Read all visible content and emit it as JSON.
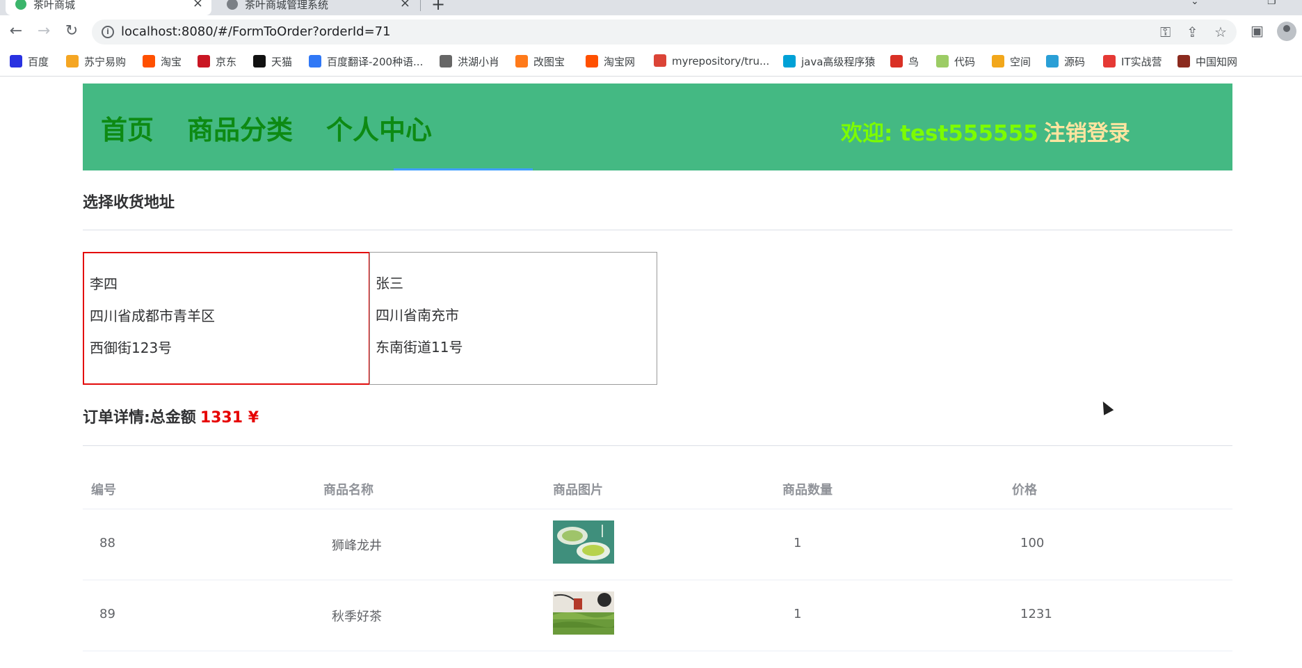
{
  "browser": {
    "tabs": [
      {
        "title": "茶叶商城",
        "active": true
      },
      {
        "title": "茶叶商城管理系统",
        "active": false
      }
    ],
    "url": "localhost:8080/#/FormToOrder?orderId=71",
    "bookmarks": [
      {
        "label": "百度",
        "icon": "baidu-paw-icon",
        "color": "#2932e1"
      },
      {
        "label": "苏宁易购",
        "icon": "suning-lion-icon",
        "color": "#f5a623"
      },
      {
        "label": "淘宝",
        "icon": "taobao-icon",
        "color": "#ff5000"
      },
      {
        "label": "京东",
        "icon": "jd-icon",
        "color": "#c91623"
      },
      {
        "label": "天猫",
        "icon": "tmall-icon",
        "color": "#111111"
      },
      {
        "label": "百度翻译-200种语...",
        "icon": "translate-icon",
        "color": "#3078f6"
      },
      {
        "label": "洪湖小肖",
        "icon": "bird-icon",
        "color": "#666666"
      },
      {
        "label": "改图宝",
        "icon": "gaitubao-icon",
        "color": "#ff7a1a"
      },
      {
        "label": "淘宝网",
        "icon": "taobao-icon",
        "color": "#ff5000"
      },
      {
        "label": "myrepository/tru...",
        "icon": "chrome-icon",
        "color": "#db4437"
      },
      {
        "label": "java高级程序猿",
        "icon": "bilibili-icon",
        "color": "#00a1d6"
      },
      {
        "label": "鸟",
        "icon": "bird-icon",
        "color": "#d93025"
      },
      {
        "label": "代码",
        "icon": "code-icon",
        "color": "#9ccc65"
      },
      {
        "label": "空间",
        "icon": "qzone-icon",
        "color": "#f2a71b"
      },
      {
        "label": "源码",
        "icon": "fish-icon",
        "color": "#2a9fd6"
      },
      {
        "label": "IT实战营",
        "icon": "chrome-icon",
        "color": "#e53935"
      },
      {
        "label": "中国知网",
        "icon": "cnki-icon",
        "color": "#8b2a1e"
      }
    ]
  },
  "nav": {
    "items": [
      "首页",
      "商品分类",
      "个人中心"
    ],
    "welcome_label": "欢迎: test555555",
    "logout_label": "注销登录"
  },
  "address_section": {
    "title": "选择收货地址"
  },
  "addresses": [
    {
      "name": "李四",
      "line1": "四川省成都市青羊区",
      "line2": "西御街123号",
      "selected": true
    },
    {
      "name": "张三",
      "line1": "四川省南充市",
      "line2": "东南街道11号",
      "selected": false
    }
  ],
  "order": {
    "title": "订单详情:总金额",
    "total": "1331 ¥",
    "columns": [
      "编号",
      "商品名称",
      "商品图片",
      "商品数量",
      "价格"
    ],
    "rows": [
      {
        "id": "88",
        "name": "狮峰龙井",
        "image": "longjing-tea-thumbnail",
        "qty": "1",
        "price": "100"
      },
      {
        "id": "89",
        "name": "秋季好茶",
        "image": "autumn-tea-thumbnail",
        "qty": "1",
        "price": "1231"
      }
    ]
  },
  "colors": {
    "nav_bg": "#44b983",
    "nav_text": "#0d8a13",
    "welcome": "#7cfc00",
    "selected_border": "#e30b0b",
    "total_amount": "#e60000"
  }
}
